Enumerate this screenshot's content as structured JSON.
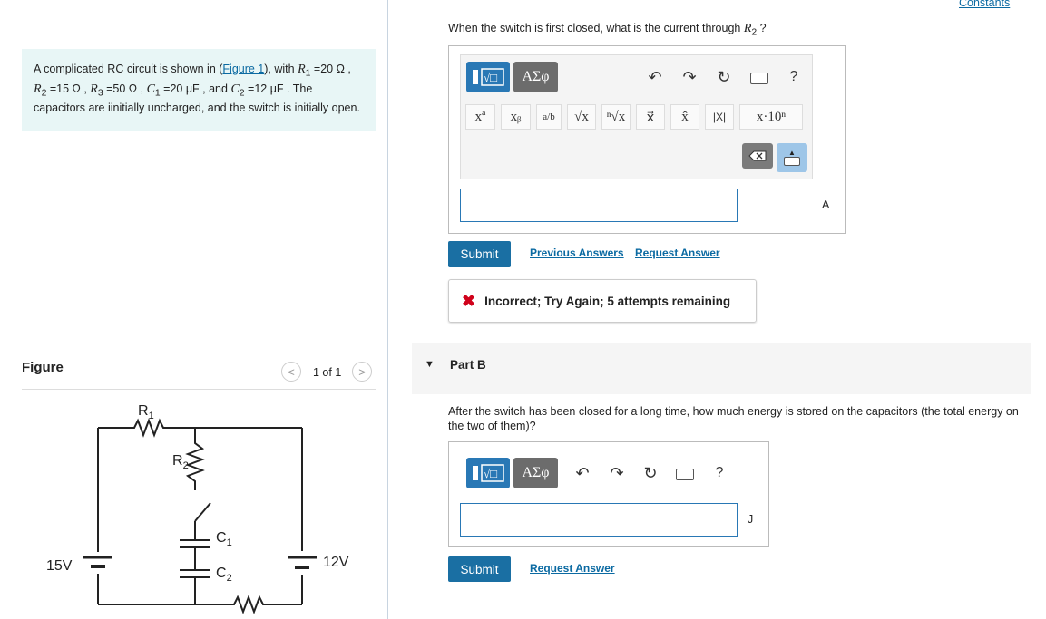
{
  "problem": {
    "text_1": "A complicated RC circuit is shown in (",
    "figure_link": "Figure 1",
    "text_2": "), with ",
    "r1": "R",
    "r1_eq": " =20 Ω , ",
    "r2_eq": " =15 Ω , ",
    "r3_eq": " =50 Ω , ",
    "c1_eq": " =20 μF , and ",
    "c2_eq": " =12 μF . The capacitors are iinitially uncharged, and the switch is initially open."
  },
  "figure": {
    "title": "Figure",
    "pager": "1 of 1",
    "prev": "<",
    "next": ">",
    "labels": {
      "r1": "R",
      "r1_sub": "1",
      "r2": "R",
      "r2_sub": "2",
      "c1": "C",
      "c1_sub": "1",
      "c2": "C",
      "c2_sub": "2",
      "v1": "15V",
      "v2": "12V"
    }
  },
  "header": {
    "constants_link": "Constants"
  },
  "part_a": {
    "question_pre": "When the switch is first closed, what is the current through ",
    "question_var": "R",
    "question_sub": "2",
    "question_post": " ?",
    "toolbar": {
      "greek": "ΑΣφ",
      "help": "?",
      "symbols": [
        "xª",
        "xᵦ",
        "a/b",
        "√x",
        "ⁿ√x",
        "x⃗",
        "x̂",
        "|X|",
        "x·10ⁿ"
      ]
    },
    "input_value": "",
    "unit": "A",
    "submit": "Submit",
    "previous_answers": "Previous Answers",
    "request_answer": "Request Answer",
    "feedback": "Incorrect; Try Again; 5 attempts remaining"
  },
  "part_b": {
    "title": "Part B",
    "question": "After the switch has been closed for a long time, how much energy is stored on the capacitors (the total energy on the two of them)?",
    "toolbar": {
      "greek": "ΑΣφ",
      "help": "?"
    },
    "input_value": "",
    "unit": "J",
    "submit": "Submit",
    "request_answer": "Request Answer"
  },
  "colors": {
    "accent": "#1a6fa3",
    "problem_bg": "#e8f6f6",
    "error": "#d0021b"
  }
}
